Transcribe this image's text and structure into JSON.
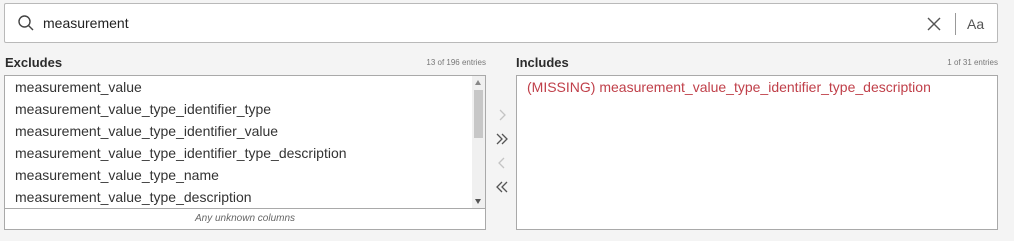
{
  "search": {
    "value": "measurement",
    "case_label": "Aa"
  },
  "excludes": {
    "title": "Excludes",
    "count": "13 of 196 entries",
    "items": [
      "measurement_value",
      "measurement_value_type_identifier_type",
      "measurement_value_type_identifier_value",
      "measurement_value_type_identifier_type_description",
      "measurement_value_type_name",
      "measurement_value_type_description"
    ],
    "footer": "Any unknown columns"
  },
  "includes": {
    "title": "Includes",
    "count": "1 of 31 entries",
    "items": [
      "(MISSING) measurement_value_type_identifier_type_description"
    ]
  },
  "colors": {
    "missing_text": "#c0404a",
    "border": "#a9a9a9",
    "background": "#f4f4f4"
  },
  "icons": [
    "search-icon",
    "clear-icon",
    "move-right-icon",
    "move-all-right-icon",
    "move-left-icon",
    "move-all-left-icon"
  ]
}
